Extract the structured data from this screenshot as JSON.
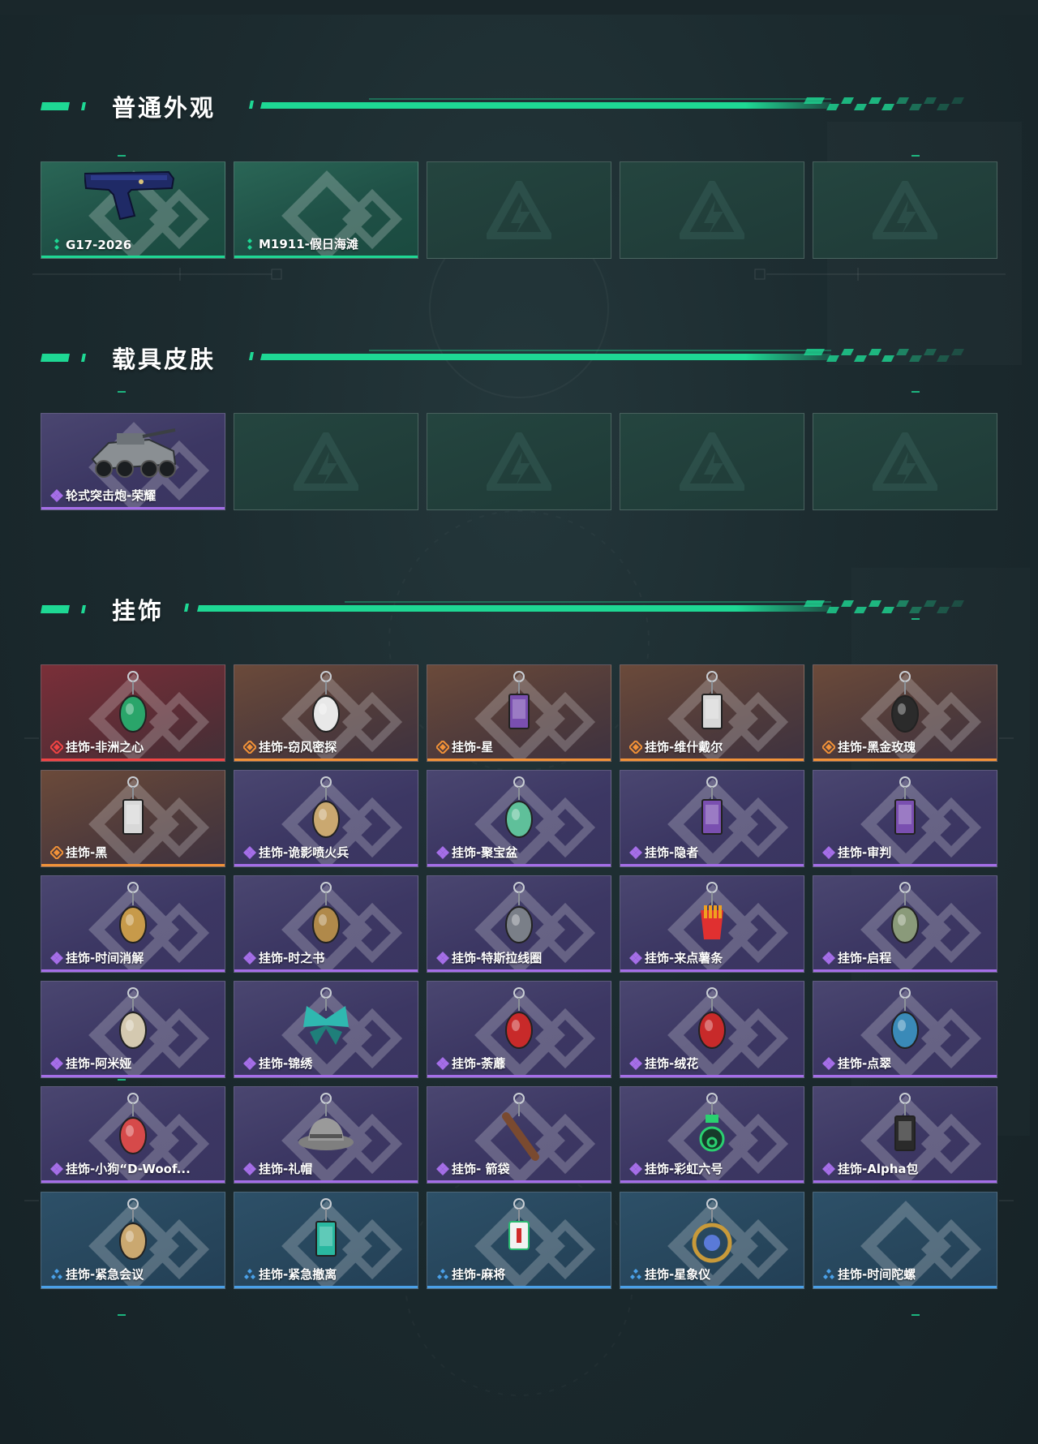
{
  "colors": {
    "accent": "#1ed894",
    "green": "#1ed894",
    "purple": "#a56ee8",
    "orange": "#f29238",
    "red": "#f04444",
    "blue": "#4aa0e8"
  },
  "sections": {
    "skins": {
      "title": "普通外观",
      "items": [
        {
          "label": "G17-2026",
          "quality": "green",
          "icon": "pistol-icon"
        },
        {
          "label": "M1911-假日海滩",
          "quality": "green",
          "icon": ""
        },
        {
          "label": "",
          "quality": "empty",
          "icon": "logo-watermark-icon"
        },
        {
          "label": "",
          "quality": "empty",
          "icon": "logo-watermark-icon"
        },
        {
          "label": "",
          "quality": "empty",
          "icon": "logo-watermark-icon"
        }
      ]
    },
    "vehicles": {
      "title": "载具皮肤",
      "items": [
        {
          "label": "轮式突击炮-荣耀",
          "quality": "purple",
          "icon": "armored-vehicle-icon"
        },
        {
          "label": "",
          "quality": "empty",
          "icon": "logo-watermark-icon"
        },
        {
          "label": "",
          "quality": "empty",
          "icon": "logo-watermark-icon"
        },
        {
          "label": "",
          "quality": "empty",
          "icon": "logo-watermark-icon"
        },
        {
          "label": "",
          "quality": "empty",
          "icon": "logo-watermark-icon"
        }
      ]
    },
    "charms": {
      "title": "挂饰",
      "items": [
        {
          "label": "挂饰-非洲之心",
          "quality": "red",
          "icon": "gem-charm-icon"
        },
        {
          "label": "挂饰-窃风密探",
          "quality": "orange",
          "icon": "rabbit-charm-icon"
        },
        {
          "label": "挂饰-星",
          "quality": "orange",
          "icon": "card-charm-icon"
        },
        {
          "label": "挂饰-维什戴尔",
          "quality": "orange",
          "icon": "tag-charm-icon"
        },
        {
          "label": "挂饰-黑金玫瑰",
          "quality": "orange",
          "icon": "rose-charm-icon"
        },
        {
          "label": "挂饰-黑",
          "quality": "orange",
          "icon": "tag-charm-icon"
        },
        {
          "label": "挂饰-诡影喷火兵",
          "quality": "purple",
          "icon": "figure-charm-icon"
        },
        {
          "label": "挂饰-聚宝盆",
          "quality": "purple",
          "icon": "bowl-charm-icon"
        },
        {
          "label": "挂饰-隐者",
          "quality": "purple",
          "icon": "card-charm-icon"
        },
        {
          "label": "挂饰-审判",
          "quality": "purple",
          "icon": "card-charm-icon"
        },
        {
          "label": "挂饰-时间消解",
          "quality": "purple",
          "icon": "amulet-charm-icon"
        },
        {
          "label": "挂饰-时之书",
          "quality": "purple",
          "icon": "book-charm-icon"
        },
        {
          "label": "挂饰-特斯拉线圈",
          "quality": "purple",
          "icon": "coil-charm-icon"
        },
        {
          "label": "挂饰-来点薯条",
          "quality": "purple",
          "icon": "fries-charm-icon"
        },
        {
          "label": "挂饰-启程",
          "quality": "purple",
          "icon": "ring-charm-icon"
        },
        {
          "label": "挂饰-阿米娅",
          "quality": "purple",
          "icon": "bunny-charm-icon"
        },
        {
          "label": "挂饰-锦绣",
          "quality": "purple",
          "icon": "butterfly-charm-icon"
        },
        {
          "label": "挂饰-荼蘼",
          "quality": "purple",
          "icon": "flower-charm-icon"
        },
        {
          "label": "挂饰-绒花",
          "quality": "purple",
          "icon": "flower-charm-icon"
        },
        {
          "label": "挂饰-点翠",
          "quality": "purple",
          "icon": "feather-charm-icon"
        },
        {
          "label": "挂饰-小狗“D-Woof...",
          "quality": "purple",
          "icon": "dog-charm-icon"
        },
        {
          "label": "挂饰-礼帽",
          "quality": "purple",
          "icon": "hat-charm-icon"
        },
        {
          "label": "挂饰- 箭袋",
          "quality": "purple",
          "icon": "quiver-charm-icon"
        },
        {
          "label": "挂饰-彩虹六号",
          "quality": "purple",
          "icon": "six-charm-icon"
        },
        {
          "label": "挂饰-Alpha包",
          "quality": "purple",
          "icon": "bag-charm-icon"
        },
        {
          "label": "挂饰-紧急会议",
          "quality": "blue",
          "icon": "figure-charm-icon"
        },
        {
          "label": "挂饰-紧急撤离",
          "quality": "blue",
          "icon": "frame-charm-icon"
        },
        {
          "label": "挂饰-麻将",
          "quality": "blue",
          "icon": "mahjong-charm-icon"
        },
        {
          "label": "挂饰-星象仪",
          "quality": "blue",
          "icon": "astrolabe-charm-icon"
        },
        {
          "label": "挂饰-时间陀螺",
          "quality": "blue",
          "icon": ""
        }
      ]
    }
  }
}
